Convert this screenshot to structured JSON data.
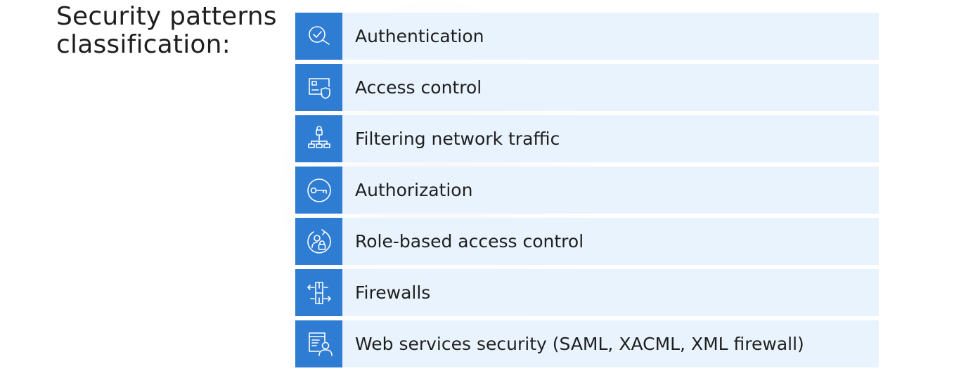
{
  "title": {
    "line1": "Security patterns",
    "line2": "classification:"
  },
  "items": [
    {
      "label": "Authentication",
      "icon": "magnifier-check-icon"
    },
    {
      "label": "Access control",
      "icon": "card-shield-icon"
    },
    {
      "label": "Filtering network traffic",
      "icon": "lock-network-icon"
    },
    {
      "label": "Authorization",
      "icon": "key-circle-icon"
    },
    {
      "label": "Role-based access control",
      "icon": "user-lock-cycle-icon"
    },
    {
      "label": "Firewalls",
      "icon": "firewall-arrows-icon"
    },
    {
      "label": "Web services security (SAML, XACML, XML firewall)",
      "icon": "document-user-icon"
    }
  ],
  "colors": {
    "icon_background": "#2f7cd3",
    "row_background": "#e9f3fd",
    "text": "#1f1f1f"
  }
}
